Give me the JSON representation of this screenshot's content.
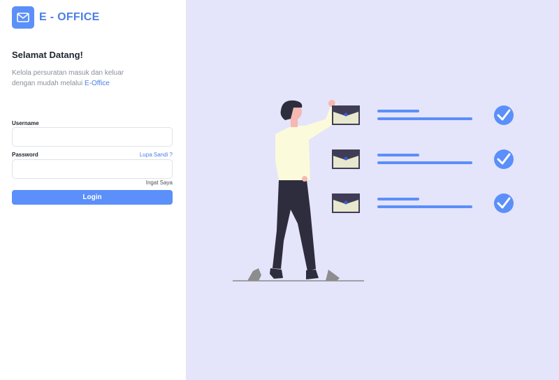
{
  "brand": {
    "name": "E - OFFICE",
    "logo_icon": "envelope-icon"
  },
  "login": {
    "welcome": "Selamat Datang!",
    "description_line1": "Kelola persuratan masuk dan keluar",
    "description_line2_prefix": "dengan mudah melalui ",
    "description_line2_accent": "E-Office",
    "username_label": "Username",
    "username_value": "",
    "password_label": "Password",
    "password_value": "",
    "forgot_label": "Lupa Sandi ?",
    "remember_label": "Ingat Saya",
    "login_button": "Login"
  },
  "colors": {
    "accent": "#5b8ff9",
    "accent_text": "#4a7fe6",
    "illustration_bg": "#e4e4fb",
    "figure_shirt": "#fbfbdc",
    "figure_pants": "#2e2d3d",
    "envelope": "#3f3d56",
    "check": "#5b8ff9"
  }
}
